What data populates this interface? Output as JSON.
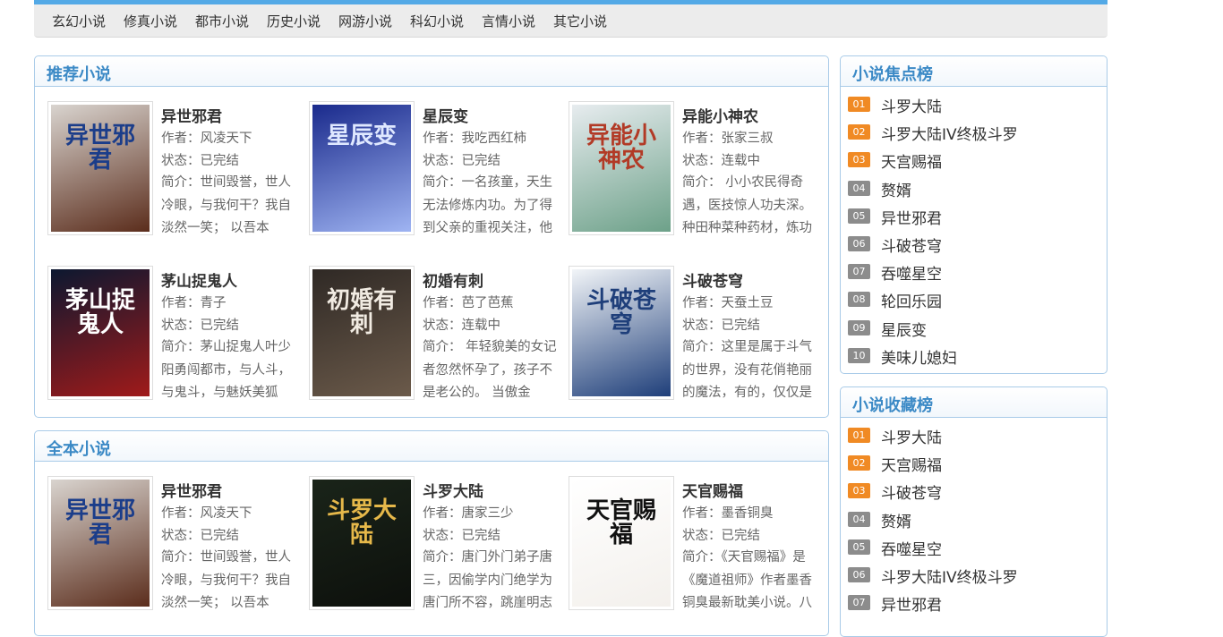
{
  "nav": [
    "玄幻小说",
    "修真小说",
    "都市小说",
    "历史小说",
    "网游小说",
    "科幻小说",
    "言情小说",
    "其它小说"
  ],
  "recommend": {
    "title": "推荐小说",
    "books": [
      {
        "title": "异世邪君",
        "author": "作者：风凌天下",
        "status": "状态：已完结",
        "desc": "简介：世间毁誉，世人冷眼，与我何干？我自淡然一笑； 以吾本",
        "cover_text": "异世邪君",
        "cover_colors": [
          "#d9d4cf",
          "#5b2d1c"
        ],
        "cover_text_color": "#1b3d8a"
      },
      {
        "title": "星辰变",
        "author": "作者：我吃西红柿",
        "status": "状态：已完结",
        "desc": "简介：一名孩童，天生无法修炼内功。为了得到父亲的重视关注，他",
        "cover_text": "星辰变",
        "cover_colors": [
          "#1a2a8c",
          "#9fb4f2"
        ],
        "cover_text_color": "#dfe8ff"
      },
      {
        "title": "异能小神农",
        "author": "作者：张家三叔",
        "status": "状态：连载中",
        "desc": "简介： 小小农民得奇遇，医技惊人功夫深。种田种菜种药材，炼功",
        "cover_text": "异能小神农",
        "cover_colors": [
          "#e7ecef",
          "#6da189"
        ],
        "cover_text_color": "#b23a26"
      },
      {
        "title": "茅山捉鬼人",
        "author": "作者：青子",
        "status": "状态：已完结",
        "desc": "简介：茅山捉鬼人叶少阳勇闯都市，与人斗，与鬼斗，与魅妖美狐",
        "cover_text": "茅山捉鬼人",
        "cover_colors": [
          "#0c1830",
          "#a01a1a"
        ],
        "cover_text_color": "#ffffff"
      },
      {
        "title": "初婚有刺",
        "author": "作者：芭了芭蕉",
        "status": "状态：连载中",
        "desc": "简介： 年轻貌美的女记者忽然怀孕了，孩子不是老公的。 当傲金",
        "cover_text": "初婚有刺",
        "cover_colors": [
          "#2f2925",
          "#6b5a4a"
        ],
        "cover_text_color": "#f1ebe2"
      },
      {
        "title": "斗破苍穹",
        "author": "作者：天蚕土豆",
        "status": "状态：已完结",
        "desc": "简介：这里是属于斗气的世界，没有花俏艳丽的魔法，有的，仅仅是",
        "cover_text": "斗破苍穹",
        "cover_colors": [
          "#f2f5f8",
          "#1f3f7a"
        ],
        "cover_text_color": "#1f3f7a"
      }
    ]
  },
  "complete": {
    "title": "全本小说",
    "books": [
      {
        "title": "异世邪君",
        "author": "作者：风凌天下",
        "status": "状态：已完结",
        "desc": "简介：世间毁誉，世人冷眼，与我何干？我自淡然一笑； 以吾本",
        "cover_text": "异世邪君",
        "cover_colors": [
          "#d9d4cf",
          "#5b2d1c"
        ],
        "cover_text_color": "#1b3d8a"
      },
      {
        "title": "斗罗大陆",
        "author": "作者：唐家三少",
        "status": "状态：已完结",
        "desc": "简介：唐门外门弟子唐三，因偷学内门绝学为唐门所不容，跳崖明志",
        "cover_text": "斗罗大陆",
        "cover_colors": [
          "#1a2419",
          "#0d100c"
        ],
        "cover_text_color": "#e6b84a"
      },
      {
        "title": "天官赐福",
        "author": "作者：墨香铜臭",
        "status": "状态：已完结",
        "desc": "简介：《天官赐福》是《魔道祖师》作者墨香铜臭最新耽美小说。八",
        "cover_text": "天官赐福",
        "cover_colors": [
          "#ffffff",
          "#f3f0ec"
        ],
        "cover_text_color": "#111111"
      }
    ]
  },
  "focus": {
    "title": "小说焦点榜",
    "items": [
      {
        "num": "01",
        "name": "斗罗大陆"
      },
      {
        "num": "02",
        "name": "斗罗大陆IV终极斗罗"
      },
      {
        "num": "03",
        "name": "天宫赐福"
      },
      {
        "num": "04",
        "name": "赘婿"
      },
      {
        "num": "05",
        "name": "异世邪君"
      },
      {
        "num": "06",
        "name": "斗破苍穹"
      },
      {
        "num": "07",
        "name": "吞噬星空"
      },
      {
        "num": "08",
        "name": "轮回乐园"
      },
      {
        "num": "09",
        "name": "星辰变"
      },
      {
        "num": "10",
        "name": "美味儿媳妇"
      }
    ]
  },
  "collect": {
    "title": "小说收藏榜",
    "items": [
      {
        "num": "01",
        "name": "斗罗大陆"
      },
      {
        "num": "02",
        "name": "天宫赐福"
      },
      {
        "num": "03",
        "name": "斗破苍穹"
      },
      {
        "num": "04",
        "name": "赘婿"
      },
      {
        "num": "05",
        "name": "吞噬星空"
      },
      {
        "num": "06",
        "name": "斗罗大陆IV终极斗罗"
      },
      {
        "num": "07",
        "name": "异世邪君"
      }
    ]
  },
  "colors": {
    "accent": "#53a9e6",
    "head_text": "#3c8ac6",
    "top_rank": "#f08a24",
    "other_rank": "#8c8c8c"
  }
}
